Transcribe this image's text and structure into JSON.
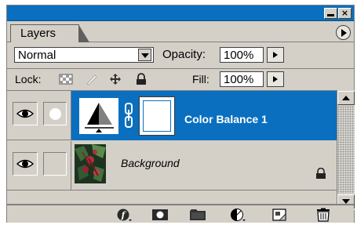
{
  "panel": {
    "tab_label": "Layers",
    "close_glyph": "×"
  },
  "blend": {
    "mode": "Normal",
    "opacity_label": "Opacity:",
    "opacity_value": "100%"
  },
  "lock": {
    "label": "Lock:",
    "fill_label": "Fill:",
    "fill_value": "100%"
  },
  "layers": [
    {
      "name": "Color Balance 1",
      "selected": true,
      "visible": true,
      "type": "adjustment"
    },
    {
      "name": "Background",
      "selected": false,
      "visible": true,
      "type": "image",
      "locked": true
    }
  ],
  "toolbar": {
    "icons": [
      "layer-style-icon",
      "add-mask-icon",
      "new-set-icon",
      "adjustment-layer-icon",
      "new-layer-icon",
      "trash-icon"
    ]
  },
  "colors": {
    "selection": "#0a6fbf",
    "panel": "#d4d0c8"
  }
}
